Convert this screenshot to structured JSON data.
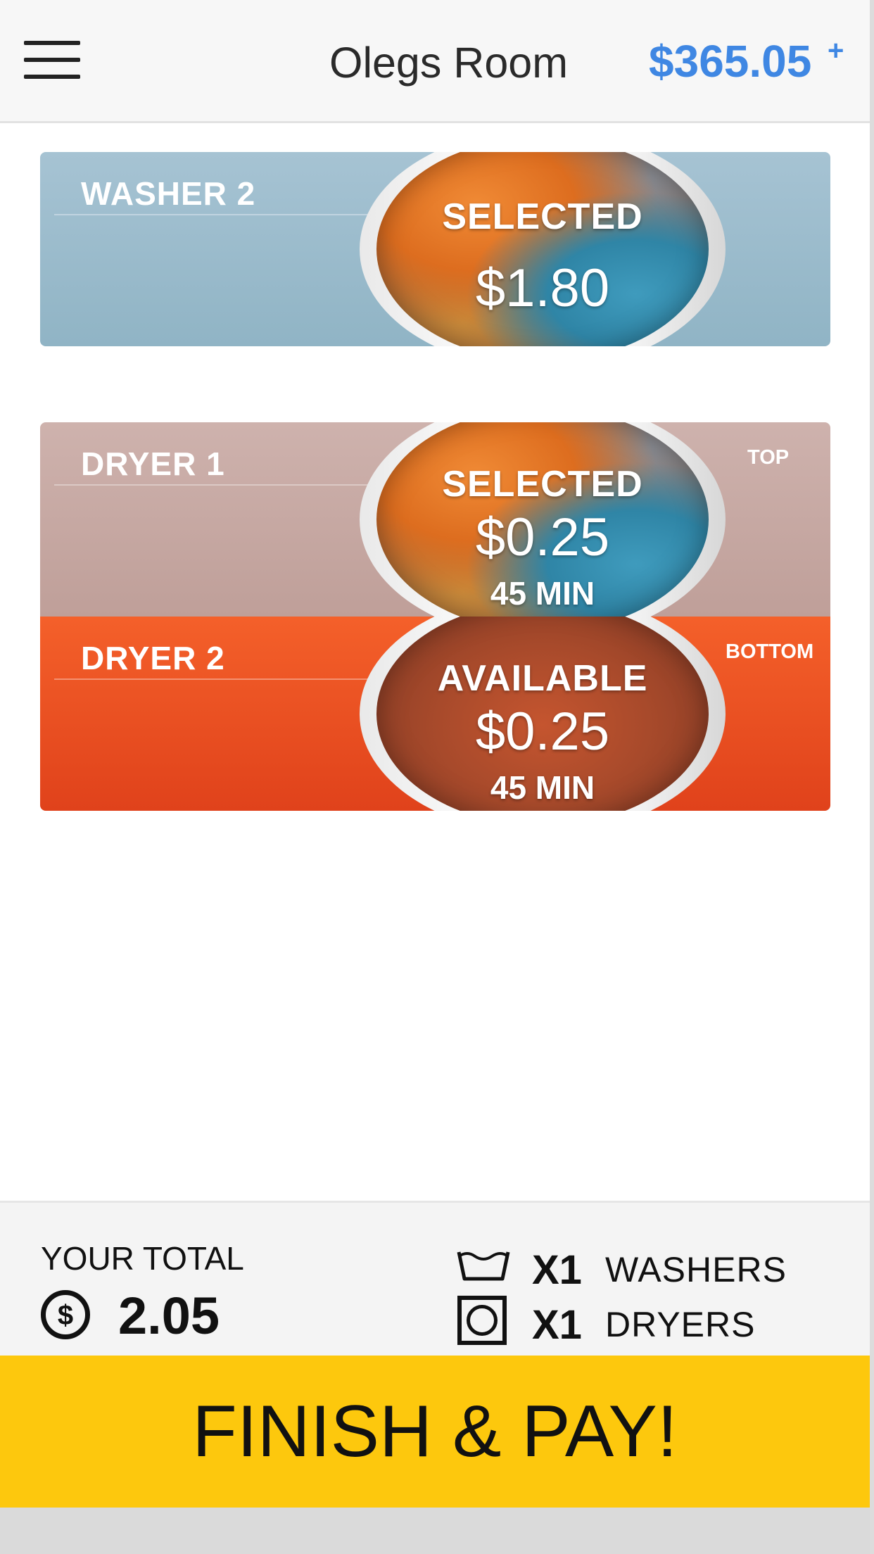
{
  "header": {
    "menu_icon": "hamburger-menu-icon",
    "title": "Olegs Room",
    "balance": "$365.05",
    "balance_add": "+"
  },
  "machines": [
    {
      "name": "WASHER 2",
      "status": "SELECTED",
      "price": "$1.80",
      "time": "",
      "position": ""
    },
    {
      "name": "DRYER 1",
      "status": "SELECTED",
      "price": "$0.25",
      "time": "45 MIN",
      "position": "TOP"
    },
    {
      "name": "DRYER 2",
      "status": "AVAILABLE",
      "price": "$0.25",
      "time": "45 MIN",
      "position": "BOTTOM"
    }
  ],
  "summary": {
    "total_label": "YOUR TOTAL",
    "currency_icon": "dollar-coin-icon",
    "total_value": "2.05",
    "washers_icon": "wash-tub-icon",
    "washers_qty": "X1",
    "washers_label": "WASHERS",
    "dryers_icon": "dryer-square-icon",
    "dryers_qty": "X1",
    "dryers_label": "DRYERS"
  },
  "pay_button": {
    "label": "FINISH & PAY!"
  },
  "colors": {
    "balance": "#3f87e3",
    "washer_card": "#9ebccc",
    "dryer1_card": "#c8aaa5",
    "dryer2_card": "#ee5424",
    "pay_button": "#fdc80d"
  }
}
